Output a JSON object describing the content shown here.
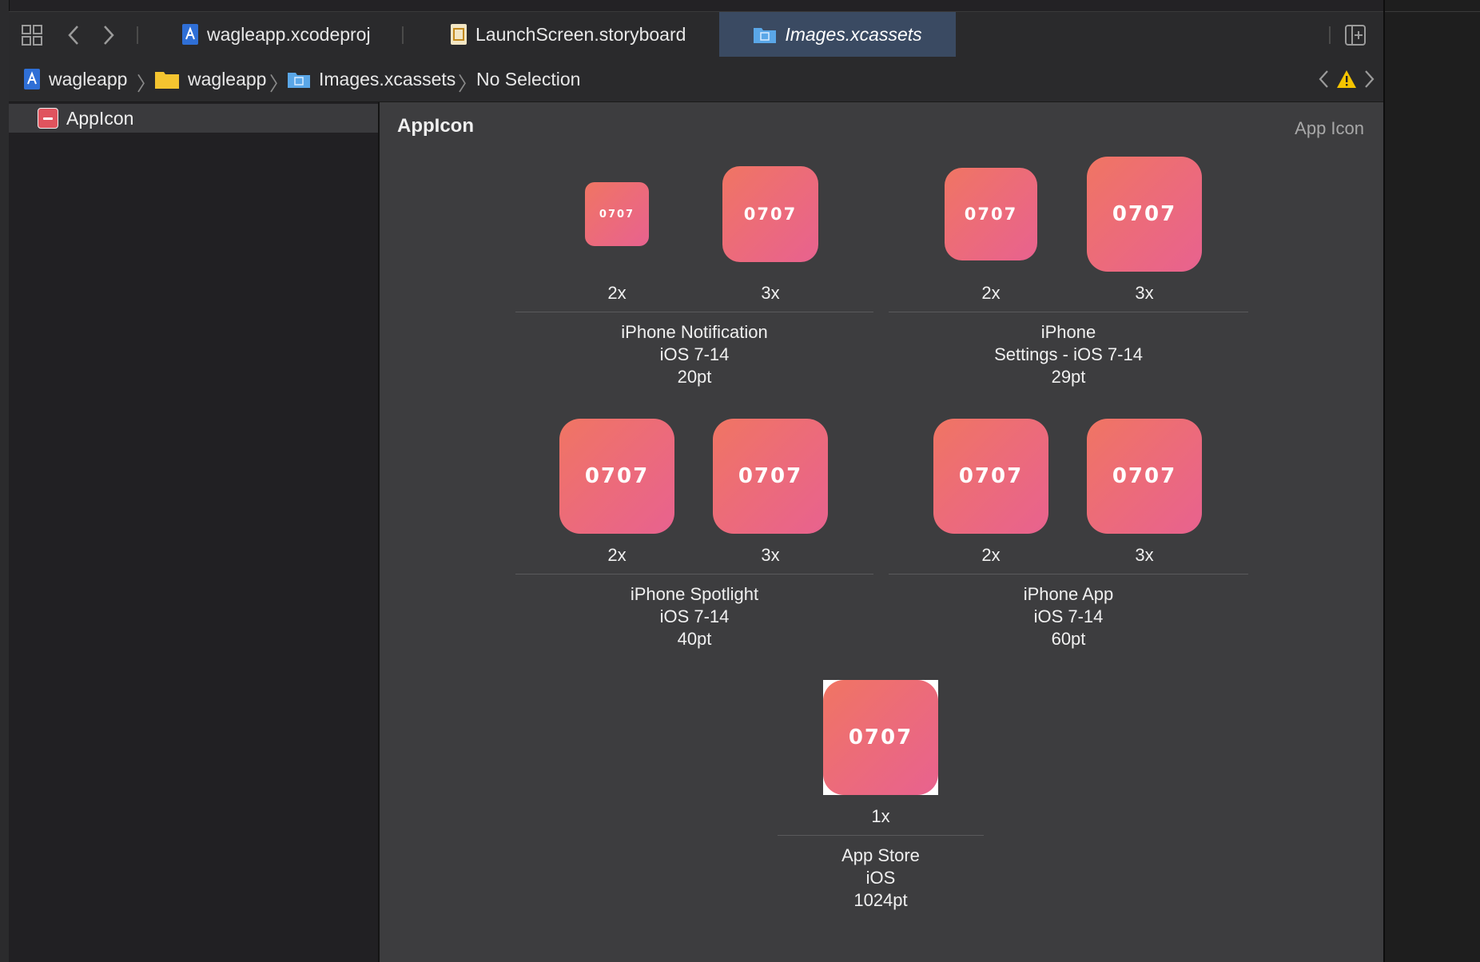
{
  "tabs": [
    {
      "label": "wagleapp.xcodeproj",
      "icon": "xcodeproj-icon"
    },
    {
      "label": "LaunchScreen.storyboard",
      "icon": "storyboard-icon"
    },
    {
      "label": "Images.xcassets",
      "icon": "asset-catalog-icon",
      "active": true
    }
  ],
  "breadcrumb": [
    {
      "label": "wagleapp",
      "icon": "xcodeproj-icon"
    },
    {
      "label": "wagleapp",
      "icon": "folder-icon"
    },
    {
      "label": "Images.xcassets",
      "icon": "asset-catalog-icon"
    },
    {
      "label": "No Selection"
    }
  ],
  "navigator": {
    "items": [
      {
        "label": "AppIcon"
      }
    ]
  },
  "editor": {
    "title": "AppIcon",
    "kind": "App Icon"
  },
  "icon_text": "0707",
  "groups": [
    {
      "line1": "iPhone Notification",
      "line2": "iOS 7-14",
      "line3": "20pt",
      "scales": [
        "2x",
        "3x"
      ]
    },
    {
      "line1": "iPhone",
      "line2": "Settings - iOS 7-14",
      "line3": "29pt",
      "scales": [
        "2x",
        "3x"
      ]
    },
    {
      "line1": "iPhone Spotlight",
      "line2": "iOS 7-14",
      "line3": "40pt",
      "scales": [
        "2x",
        "3x"
      ]
    },
    {
      "line1": "iPhone App",
      "line2": "iOS 7-14",
      "line3": "60pt",
      "scales": [
        "2x",
        "3x"
      ]
    },
    {
      "line1": "App Store",
      "line2": "iOS",
      "line3": "1024pt",
      "scales": [
        "1x"
      ]
    }
  ],
  "colors": {
    "accent_tab": "#3a4a62",
    "icon_gradient_start": "#f07563",
    "icon_gradient_end": "#e8628f",
    "warning": "#f5c400"
  }
}
